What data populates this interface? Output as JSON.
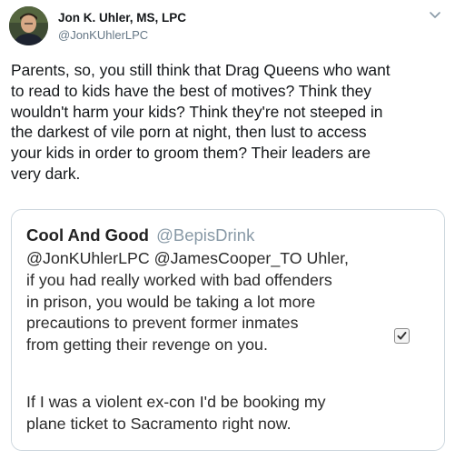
{
  "tweet": {
    "author_name": "Jon K. Uhler, MS, LPC",
    "author_handle": "@JonKUhlerLPC",
    "text": "Parents, so, you still think that Drag Queens who want\nto read to kids have the best of motives? Think they\nwouldn't harm your kids? Think they're not steeped in\nthe darkest of vile porn at night, then lust to access\nyour kids in order to groom them? Their leaders are\nvery dark."
  },
  "icons": {
    "avatar": "profile-photo",
    "menu": "chevron-down-icon",
    "checkbox": "checkbox-checked-icon"
  },
  "quote": {
    "name": "Cool And Good",
    "handle": "@BepisDrink",
    "body": "@JonKUhlerLPC @JamesCooper_TO Uhler,\nif you had really worked with bad offenders\nin prison, you would be taking a lot more\nprecautions to prevent former inmates\nfrom getting their revenge on you.",
    "body2": "If I was a violent ex-con I'd be booking my\nplane ticket to Sacramento right now."
  },
  "colors": {
    "name": "#14171a",
    "handle": "#657786",
    "border": "#ccd6dd"
  }
}
